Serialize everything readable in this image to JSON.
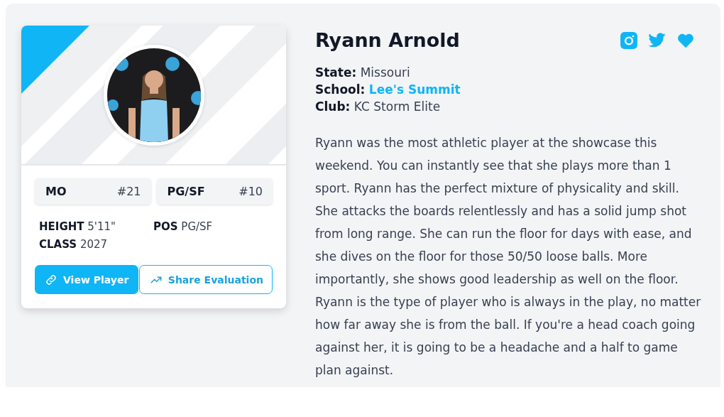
{
  "card": {
    "tags": [
      {
        "label": "MO",
        "rank": "#21"
      },
      {
        "label": "PG/SF",
        "rank": "#10"
      }
    ],
    "stats": [
      {
        "label": "HEIGHT",
        "value": "5'11\""
      },
      {
        "label": "POS",
        "value": "PG/SF"
      },
      {
        "label": "CLASS",
        "value": "2027"
      }
    ],
    "buttons": [
      {
        "label": "View Player",
        "kind": "primary"
      },
      {
        "label": "Share Evaluation",
        "kind": "outline"
      }
    ]
  },
  "profile": {
    "name": "Ryann Arnold",
    "details": [
      {
        "label": "State:",
        "value": "Missouri",
        "kind": "text"
      },
      {
        "label": "School:",
        "value": "Lee's Summit",
        "kind": "link"
      },
      {
        "label": "Club:",
        "value": "KC Storm Elite",
        "kind": "text"
      }
    ],
    "evaluation": "Ryann was the most athletic player at the showcase this weekend. You can instantly see that she plays more than 1 sport. Ryann has the perfect mixture of physicality and skill. She attacks the boards relentlessly and has a solid jump shot from long range. She can run the floor for days with ease, and she dives on the floor for those 50/50 loose balls. More importantly, she shows good leadership as well on the floor. Ryann is the type of player who is always in the play, no matter how far away she is from the ball. If you're a head coach going against her, it is going to be a headache and a half to game plan against."
  }
}
